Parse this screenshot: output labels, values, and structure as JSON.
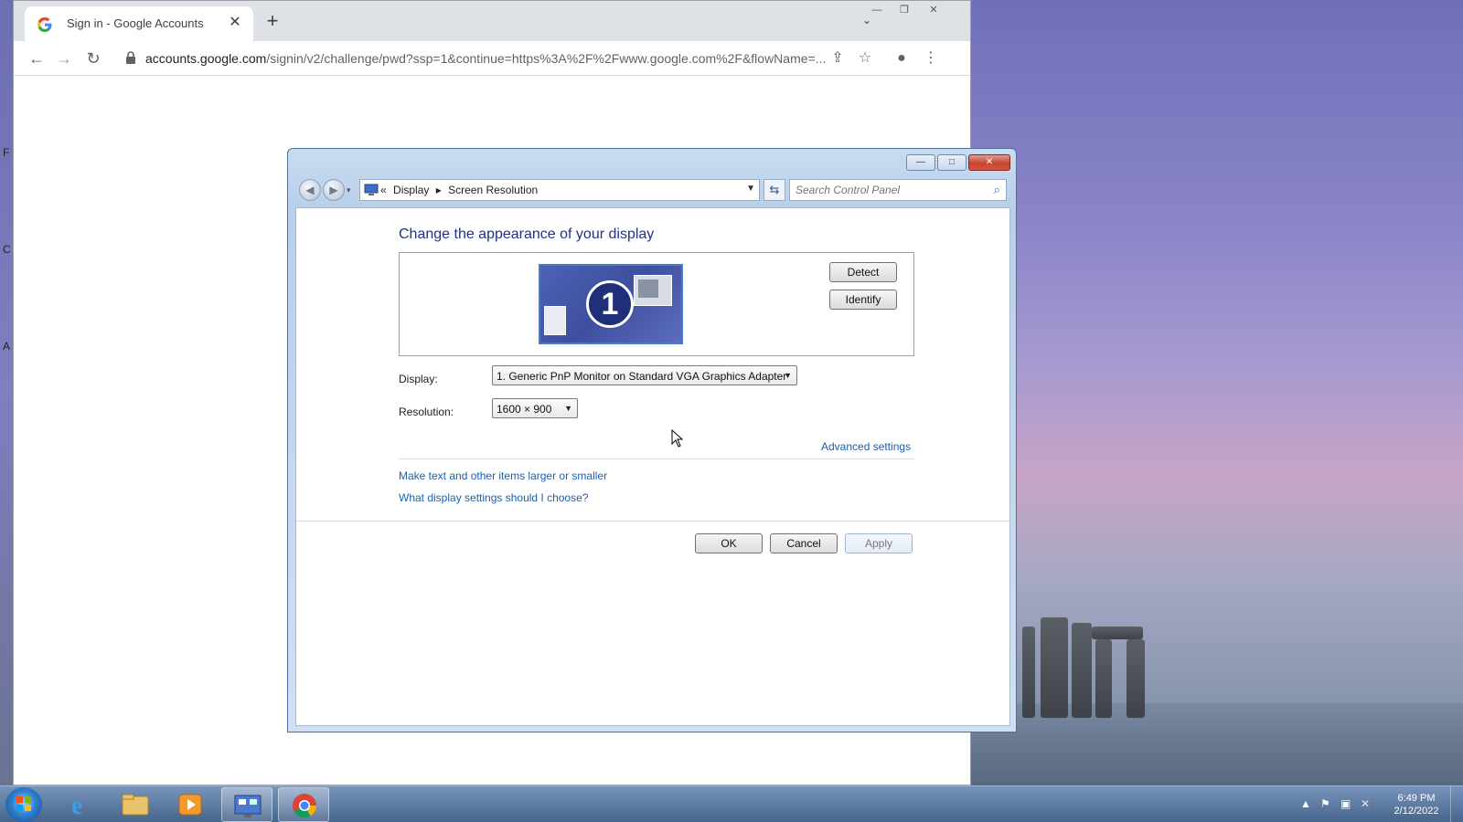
{
  "browser": {
    "tab_title": "Sign in - Google Accounts",
    "tab_close_icon": "close-icon",
    "new_tab_symbol": "+",
    "url_host": "accounts.google.com",
    "url_path": "/signin/v2/challenge/pwd?ssp=1&continue=https%3A%2F%2Fwww.google.com%2F&flowName=..."
  },
  "dialog": {
    "breadcrumb": {
      "prefix": "«",
      "items": [
        "Display",
        "Screen Resolution"
      ]
    },
    "search_placeholder": "Search Control Panel",
    "heading": "Change the appearance of your display",
    "monitor_number": "1",
    "detect_label": "Detect",
    "identify_label": "Identify",
    "display_label": "Display:",
    "display_value": "1. Generic PnP Monitor on Standard VGA Graphics Adapter",
    "resolution_label": "Resolution:",
    "resolution_value": "1600 × 900",
    "advanced_link": "Advanced settings",
    "text_size_link": "Make text and other items larger or smaller",
    "help_link": "What display settings should I choose?",
    "ok_label": "OK",
    "cancel_label": "Cancel",
    "apply_label": "Apply"
  },
  "taskbar": {
    "time": "6:49 PM",
    "date": "2/12/2022"
  },
  "desktop": {
    "strip_chars": [
      "F",
      "C",
      "A"
    ]
  },
  "colors": {
    "link": "#1c5faf",
    "heading": "#1e3287",
    "close_button": "#c64631"
  }
}
